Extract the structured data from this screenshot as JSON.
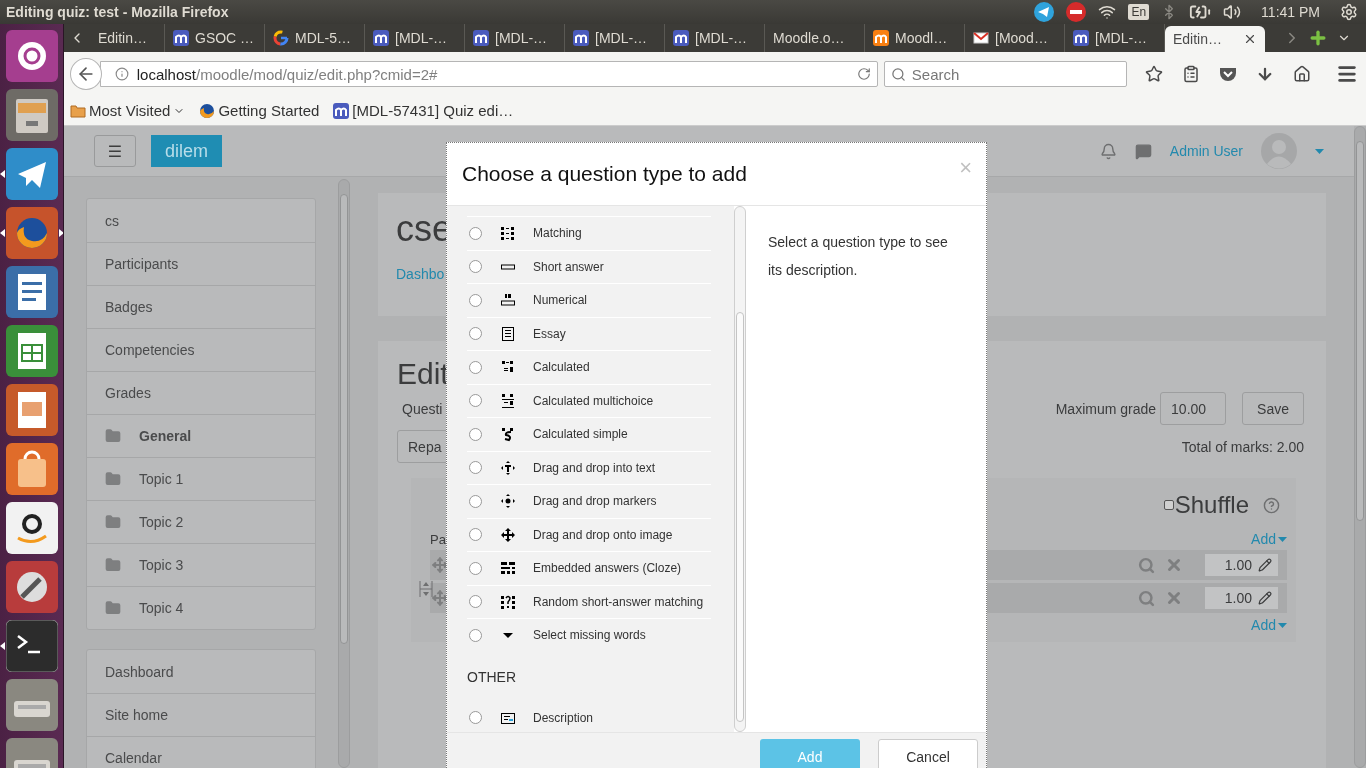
{
  "top_panel": {
    "title": "Editing quiz: test - Mozilla Firefox",
    "keyboard": "En",
    "clock": "11:41 PM"
  },
  "launcher": [
    {
      "kind": "ubuntu",
      "running": false,
      "focused": false
    },
    {
      "kind": "files",
      "running": false,
      "focused": false
    },
    {
      "kind": "telegram",
      "running": true,
      "focused": false
    },
    {
      "kind": "firefox",
      "running": true,
      "focused": true
    },
    {
      "kind": "writer",
      "running": false,
      "focused": false
    },
    {
      "kind": "calc",
      "running": false,
      "focused": false
    },
    {
      "kind": "impress",
      "running": false,
      "focused": false
    },
    {
      "kind": "store",
      "running": false,
      "focused": false
    },
    {
      "kind": "amazon",
      "running": false,
      "focused": false
    },
    {
      "kind": "settings",
      "running": false,
      "focused": false
    },
    {
      "kind": "terminal",
      "running": true,
      "focused": false
    },
    {
      "kind": "drive",
      "running": false,
      "focused": false
    },
    {
      "kind": "drive",
      "running": false,
      "focused": false
    }
  ],
  "browser": {
    "tabs": [
      {
        "label": "Editin…",
        "kind": "plain",
        "selected": false
      },
      {
        "label": "GSOC …",
        "kind": "moodle",
        "selected": false
      },
      {
        "label": "MDL-5…",
        "kind": "google",
        "selected": false
      },
      {
        "label": "[MDL-…",
        "kind": "moodle",
        "selected": false
      },
      {
        "label": "[MDL-…",
        "kind": "moodle",
        "selected": false
      },
      {
        "label": "[MDL-…",
        "kind": "moodle",
        "selected": false
      },
      {
        "label": "[MDL-…",
        "kind": "moodle",
        "selected": false
      },
      {
        "label": "Moodle.o…",
        "kind": "plain",
        "selected": false
      },
      {
        "label": "Moodl…",
        "kind": "moodle-orange",
        "selected": false
      },
      {
        "label": "[Mood…",
        "kind": "gmail",
        "selected": false
      },
      {
        "label": "[MDL-…",
        "kind": "moodle",
        "selected": false
      },
      {
        "label": "Editin…",
        "kind": "plain",
        "selected": true
      }
    ],
    "url_host": "localhost",
    "url_path": "/moodle/mod/quiz/edit.php?cmid=2#",
    "search_placeholder": "Search",
    "bookmarks": [
      {
        "label": "Most Visited",
        "kind": "folder",
        "dropdown": true
      },
      {
        "label": "Getting Started",
        "kind": "firefox",
        "dropdown": false
      },
      {
        "label": "[MDL-57431] Quiz edi…",
        "kind": "moodle",
        "dropdown": false
      }
    ]
  },
  "navbar": {
    "menu_button": "☰",
    "brand": "dilem",
    "user": "Admin User"
  },
  "sidebar": {
    "groups": [
      {
        "items": [
          {
            "label": "cs",
            "kind": "link",
            "current": false
          },
          {
            "label": "Participants",
            "kind": "link",
            "current": false
          },
          {
            "label": "Badges",
            "kind": "link",
            "current": false
          },
          {
            "label": "Competencies",
            "kind": "link",
            "current": false
          },
          {
            "label": "Grades",
            "kind": "link",
            "current": false
          },
          {
            "label": "General",
            "kind": "section",
            "current": true
          },
          {
            "label": "Topic 1",
            "kind": "section",
            "current": false
          },
          {
            "label": "Topic 2",
            "kind": "section",
            "current": false
          },
          {
            "label": "Topic 3",
            "kind": "section",
            "current": false
          },
          {
            "label": "Topic 4",
            "kind": "section",
            "current": false
          }
        ]
      },
      {
        "items": [
          {
            "label": "Dashboard",
            "kind": "link",
            "current": false
          },
          {
            "label": "Site home",
            "kind": "link",
            "current": false
          },
          {
            "label": "Calendar",
            "kind": "link",
            "current": false
          }
        ]
      }
    ]
  },
  "course": {
    "heading": "cse",
    "breadcrumb": "Dashbo"
  },
  "quiz": {
    "heading": "Edit",
    "questions_label": "Questi",
    "max_grade_label": "Maximum grade",
    "max_grade_value": "10.00",
    "save": "Save",
    "repaginate": "Repa",
    "total_marks": "Total of marks: 2.00",
    "section": {
      "shuffle_label": "Shuffle",
      "shuffle_checked": false,
      "add_top": "Add",
      "page_label": "Pa",
      "questions": [
        {
          "mark": "1.00"
        },
        {
          "mark": "1.00"
        }
      ],
      "add_bottom": "Add"
    }
  },
  "dialog": {
    "title": "Choose a question type to add",
    "close": "×",
    "types": [
      {
        "label": "Matching",
        "kind": "match",
        "selected": false
      },
      {
        "label": "Short answer",
        "kind": "shortanswer",
        "selected": false
      },
      {
        "label": "Numerical",
        "kind": "numerical",
        "selected": false
      },
      {
        "label": "Essay",
        "kind": "essay",
        "selected": false
      },
      {
        "label": "Calculated",
        "kind": "calculated",
        "selected": false
      },
      {
        "label": "Calculated multichoice",
        "kind": "calcmulti",
        "selected": false
      },
      {
        "label": "Calculated simple",
        "kind": "calcsimple",
        "selected": false
      },
      {
        "label": "Drag and drop into text",
        "kind": "ddwtos",
        "selected": false
      },
      {
        "label": "Drag and drop markers",
        "kind": "ddmarker",
        "selected": false
      },
      {
        "label": "Drag and drop onto image",
        "kind": "ddimage",
        "selected": false
      },
      {
        "label": "Embedded answers (Cloze)",
        "kind": "cloze",
        "selected": false
      },
      {
        "label": "Random short-answer matching",
        "kind": "randomsamatch",
        "selected": false
      },
      {
        "label": "Select missing words",
        "kind": "gapselect",
        "selected": false
      }
    ],
    "other_heading": "OTHER",
    "other_types": [
      {
        "label": "Description",
        "kind": "description",
        "selected": false
      }
    ],
    "description": "Select a question type to see its description.",
    "add": "Add",
    "add_disabled": true,
    "cancel": "Cancel"
  }
}
